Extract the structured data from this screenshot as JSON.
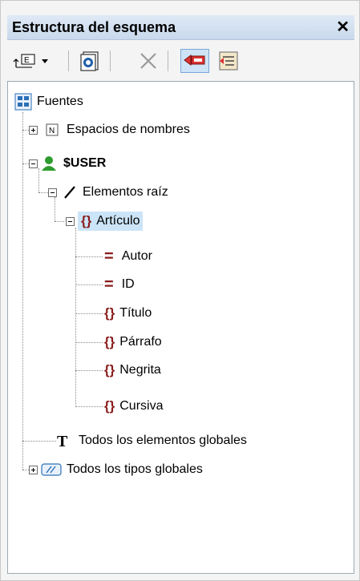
{
  "panel": {
    "title": "Estructura del esquema",
    "close_glyph": "✕"
  },
  "toolbar": {
    "buttons": [
      {
        "name": "add-component-dropdown-button",
        "icon": "add-component-icon"
      },
      {
        "name": "properties-button",
        "icon": "properties-icon"
      },
      {
        "name": "delete-button",
        "icon": "delete-icon"
      },
      {
        "name": "sync-tree-button",
        "icon": "sync-tree-icon",
        "active": true
      },
      {
        "name": "collapse-items-button",
        "icon": "collapse-icon"
      }
    ]
  },
  "tree": {
    "root": "Fuentes",
    "namespaces": "Espacios de nombres",
    "user": "$USER",
    "root_elements": "Elementos raíz",
    "articulo": "Artículo",
    "children": [
      "Autor",
      "ID",
      "Título",
      "Párrafo",
      "Negrita",
      "Cursiva"
    ],
    "global_elements": "Todos los elementos globales",
    "global_types": "Todos los tipos globales"
  },
  "colors": {
    "selection": "#cce4f7",
    "element_icon": "#8a1c1c",
    "user_icon": "#2e9b2e"
  }
}
